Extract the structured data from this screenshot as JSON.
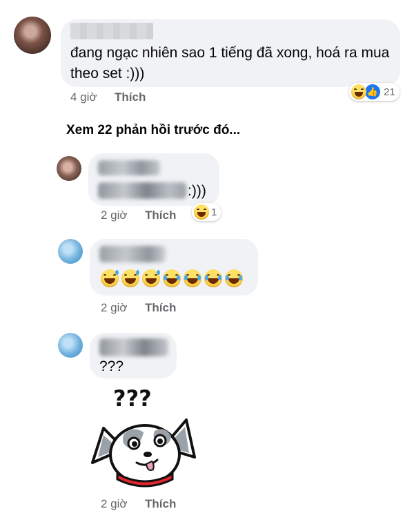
{
  "comments": [
    {
      "text": "đang ngạc nhiên sao 1 tiếng đã xong, hoá ra mua theo set :)))",
      "time": "4 giờ",
      "like_label": "Thích",
      "reaction_count": "21"
    }
  ],
  "see_more_label": "Xem 22 phản hồi trước đó...",
  "replies": [
    {
      "text": ":)))",
      "time": "2 giờ",
      "like_label": "Thích",
      "reaction_count": "1"
    },
    {
      "text": "",
      "emojis": [
        "grin-sweat",
        "grin-sweat",
        "grin-sweat",
        "cry",
        "cry",
        "cry",
        "cry"
      ],
      "time": "2 giờ",
      "like_label": "Thích"
    },
    {
      "text": "???",
      "time": "2 giờ",
      "like_label": "Thích",
      "sticker": "confused-dog-sticker",
      "sticker_text": "???"
    }
  ],
  "colors": {
    "bubble": "#f0f2f5",
    "meta_text": "#65676b",
    "like_blue": "#1877f2",
    "emoji_yellow": "#f7b928"
  }
}
